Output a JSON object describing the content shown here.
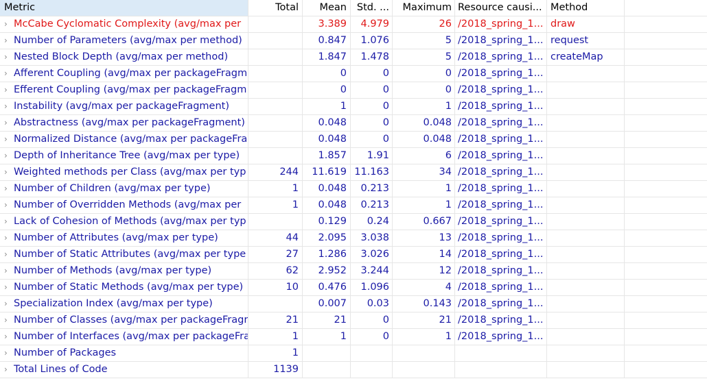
{
  "columns": {
    "metric": "Metric",
    "total": "Total",
    "mean": "Mean",
    "std": "Std. ...",
    "maximum": "Maximum",
    "resource": "Resource causi...",
    "method": "Method"
  },
  "colors": {
    "highlight": "#e01818",
    "normal": "#1a1aa6",
    "header_bg": "#dbeaf7"
  },
  "rows": [
    {
      "metric": "McCabe Cyclomatic Complexity (avg/max per",
      "total": "",
      "mean": "3.389",
      "std": "4.979",
      "max": "26",
      "resource": "/2018_spring_1...",
      "method": "draw",
      "highlight": true
    },
    {
      "metric": "Number of Parameters (avg/max per method)",
      "total": "",
      "mean": "0.847",
      "std": "1.076",
      "max": "5",
      "resource": "/2018_spring_1...",
      "method": "request"
    },
    {
      "metric": "Nested Block Depth (avg/max per method)",
      "total": "",
      "mean": "1.847",
      "std": "1.478",
      "max": "5",
      "resource": "/2018_spring_1...",
      "method": "createMap"
    },
    {
      "metric": "Afferent Coupling (avg/max per packageFragm",
      "total": "",
      "mean": "0",
      "std": "0",
      "max": "0",
      "resource": "/2018_spring_1...",
      "method": ""
    },
    {
      "metric": "Efferent Coupling (avg/max per packageFragm",
      "total": "",
      "mean": "0",
      "std": "0",
      "max": "0",
      "resource": "/2018_spring_1...",
      "method": ""
    },
    {
      "metric": "Instability (avg/max per packageFragment)",
      "total": "",
      "mean": "1",
      "std": "0",
      "max": "1",
      "resource": "/2018_spring_1...",
      "method": ""
    },
    {
      "metric": "Abstractness (avg/max per packageFragment)",
      "total": "",
      "mean": "0.048",
      "std": "0",
      "max": "0.048",
      "resource": "/2018_spring_1...",
      "method": ""
    },
    {
      "metric": "Normalized Distance (avg/max per packageFra",
      "total": "",
      "mean": "0.048",
      "std": "0",
      "max": "0.048",
      "resource": "/2018_spring_1...",
      "method": ""
    },
    {
      "metric": "Depth of Inheritance Tree (avg/max per type)",
      "total": "",
      "mean": "1.857",
      "std": "1.91",
      "max": "6",
      "resource": "/2018_spring_1...",
      "method": ""
    },
    {
      "metric": "Weighted methods per Class (avg/max per typ",
      "total": "244",
      "mean": "11.619",
      "std": "11.163",
      "max": "34",
      "resource": "/2018_spring_1...",
      "method": ""
    },
    {
      "metric": "Number of Children (avg/max per type)",
      "total": "1",
      "mean": "0.048",
      "std": "0.213",
      "max": "1",
      "resource": "/2018_spring_1...",
      "method": ""
    },
    {
      "metric": "Number of Overridden Methods (avg/max per",
      "total": "1",
      "mean": "0.048",
      "std": "0.213",
      "max": "1",
      "resource": "/2018_spring_1...",
      "method": ""
    },
    {
      "metric": "Lack of Cohesion of Methods (avg/max per typ",
      "total": "",
      "mean": "0.129",
      "std": "0.24",
      "max": "0.667",
      "resource": "/2018_spring_1...",
      "method": ""
    },
    {
      "metric": "Number of Attributes (avg/max per type)",
      "total": "44",
      "mean": "2.095",
      "std": "3.038",
      "max": "13",
      "resource": "/2018_spring_1...",
      "method": ""
    },
    {
      "metric": "Number of Static Attributes (avg/max per type",
      "total": "27",
      "mean": "1.286",
      "std": "3.026",
      "max": "14",
      "resource": "/2018_spring_1...",
      "method": ""
    },
    {
      "metric": "Number of Methods (avg/max per type)",
      "total": "62",
      "mean": "2.952",
      "std": "3.244",
      "max": "12",
      "resource": "/2018_spring_1...",
      "method": ""
    },
    {
      "metric": "Number of Static Methods (avg/max per type)",
      "total": "10",
      "mean": "0.476",
      "std": "1.096",
      "max": "4",
      "resource": "/2018_spring_1...",
      "method": ""
    },
    {
      "metric": "Specialization Index (avg/max per type)",
      "total": "",
      "mean": "0.007",
      "std": "0.03",
      "max": "0.143",
      "resource": "/2018_spring_1...",
      "method": ""
    },
    {
      "metric": "Number of Classes (avg/max per packageFragr",
      "total": "21",
      "mean": "21",
      "std": "0",
      "max": "21",
      "resource": "/2018_spring_1...",
      "method": ""
    },
    {
      "metric": "Number of Interfaces (avg/max per packageFra",
      "total": "1",
      "mean": "1",
      "std": "0",
      "max": "1",
      "resource": "/2018_spring_1...",
      "method": ""
    },
    {
      "metric": "Number of Packages",
      "total": "1",
      "mean": "",
      "std": "",
      "max": "",
      "resource": "",
      "method": ""
    },
    {
      "metric": "Total Lines of Code",
      "total": "1139",
      "mean": "",
      "std": "",
      "max": "",
      "resource": "",
      "method": ""
    }
  ]
}
